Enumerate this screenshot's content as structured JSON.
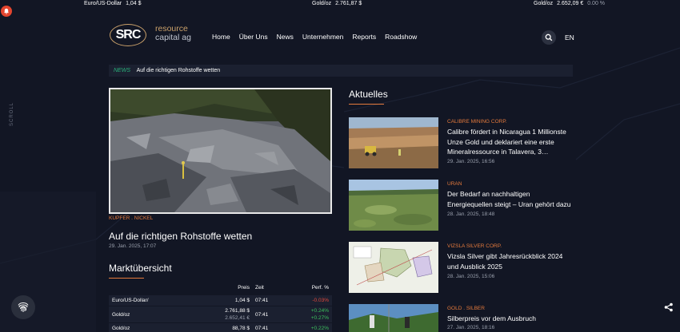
{
  "ticker": [
    {
      "label": "Euro/US-Dollar",
      "value": "1,04 $",
      "pct": ""
    },
    {
      "label": "Gold/oz",
      "value": "2.761,87 $",
      "pct": ""
    },
    {
      "label": "Gold/oz",
      "value": "2.652,09 €",
      "pct": "0.00 %"
    }
  ],
  "logo": {
    "mark": "SRC",
    "word1": "resource",
    "word2": "capital ag"
  },
  "nav": [
    "Home",
    "Über Uns",
    "News",
    "Unternehmen",
    "Reports",
    "Roadshow"
  ],
  "lang": "EN",
  "scroll_label": "SCROLL",
  "newsbar": {
    "tag": "NEWS",
    "title": "Auf die richtigen Rohstoffe wetten"
  },
  "main_article": {
    "category": "KUPFER . NICKEL",
    "title": "Auf die richtigen Rohstoffe wetten",
    "date": "29. Jan. 2025, 17:07"
  },
  "market": {
    "title": "Marktübersicht",
    "headers": {
      "preis": "Preis",
      "zeit": "Zeit",
      "perf": "Perf. %"
    },
    "rows": [
      {
        "name": "Euro/US-Dollar/",
        "preis": "1,04 $",
        "preis2": "",
        "zeit": "07:41",
        "perf": "-0.03%",
        "perf2": "",
        "dir": "neg"
      },
      {
        "name": "Gold/oz",
        "preis": "2.761,88 $",
        "preis2": "2.652,41 €",
        "zeit": "07:41",
        "perf": "+0.24%",
        "perf2": "+0.27%",
        "dir": "pos"
      },
      {
        "name": "Gold/oz",
        "preis": "88,78 $",
        "preis2": "",
        "zeit": "07:41",
        "perf": "+0.22%",
        "perf2": "",
        "dir": "pos"
      }
    ]
  },
  "aktuelles": {
    "title": "Aktuelles",
    "items": [
      {
        "category": "CALIBRE MINING CORP.",
        "title": "Calibre fördert in Nicaragua 1 Millionste Unze Gold und deklariert eine erste Mineralressource in Talavera, 3…",
        "date": "29. Jan. 2025, 16:56"
      },
      {
        "category": "URAN",
        "title": "Der Bedarf an nachhaltigen Energiequellen steigt – Uran gehört dazu",
        "date": "28. Jan. 2025, 18:48"
      },
      {
        "category": "VIZSLA SILVER CORP.",
        "title": "Vizsla Silver gibt Jahresrückblick 2024 und Ausblick 2025",
        "date": "28. Jan. 2025, 15:06"
      },
      {
        "category": "GOLD . SILBER",
        "title": "Silberpreis vor dem Ausbruch",
        "date": "27. Jan. 2025, 18:16"
      }
    ]
  },
  "colors": {
    "accent": "#e57a3c",
    "news_tag": "#29b27a",
    "negative": "#e2473a",
    "positive": "#3bbf5c",
    "background": "#121624"
  }
}
